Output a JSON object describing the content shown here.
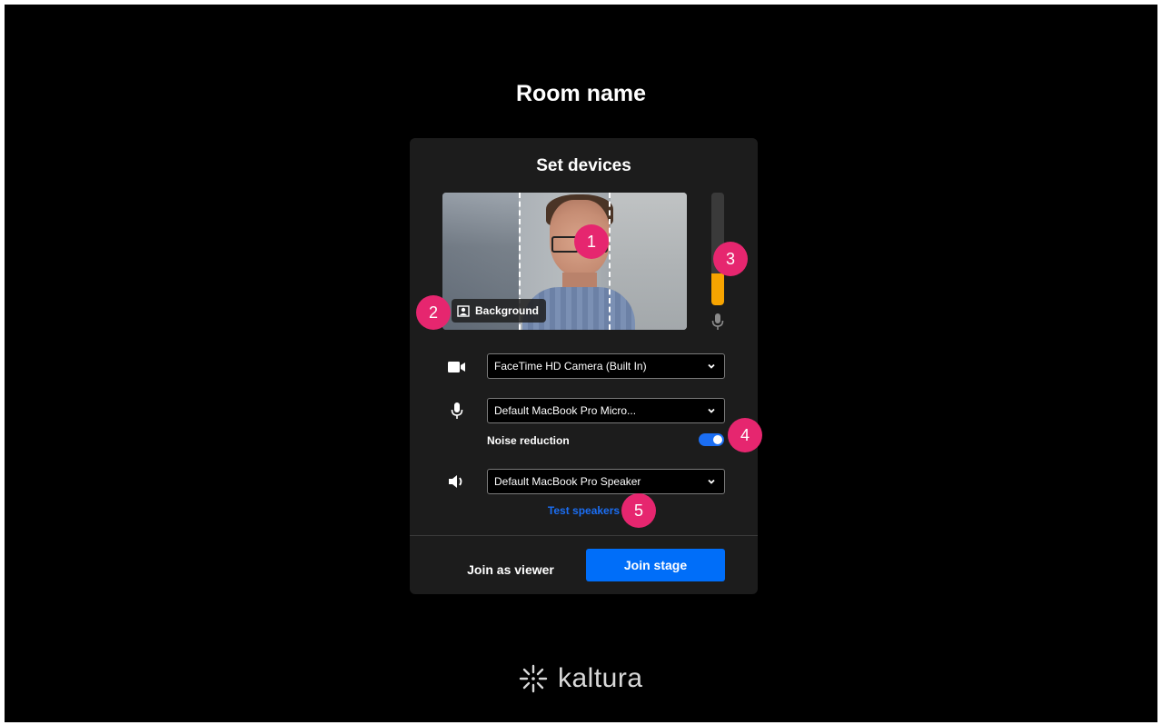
{
  "room": {
    "title": "Room name"
  },
  "panel": {
    "title": "Set devices",
    "background_button": "Background",
    "mic_level": 0.28,
    "camera": {
      "selected": "FaceTime HD Camera (Built In)"
    },
    "microphone": {
      "selected": "Default MacBook Pro Micro..."
    },
    "noise_reduction": {
      "label": "Noise reduction",
      "enabled": true
    },
    "speaker": {
      "selected": "Default MacBook Pro Speaker"
    },
    "test_speakers": "Test speakers",
    "join_viewer": "Join as viewer",
    "join_stage": "Join stage"
  },
  "markers": [
    "1",
    "2",
    "3",
    "4",
    "5"
  ],
  "brand": {
    "name": "kaltura"
  },
  "colors": {
    "accent": "#006ef9",
    "marker": "#e6266f",
    "level": "#f7a400",
    "panel": "#1c1c1c"
  },
  "icons": [
    "camera-icon",
    "microphone-icon",
    "speaker-icon",
    "background-icon",
    "chevron-down-icon",
    "kaltura-logo-icon"
  ]
}
